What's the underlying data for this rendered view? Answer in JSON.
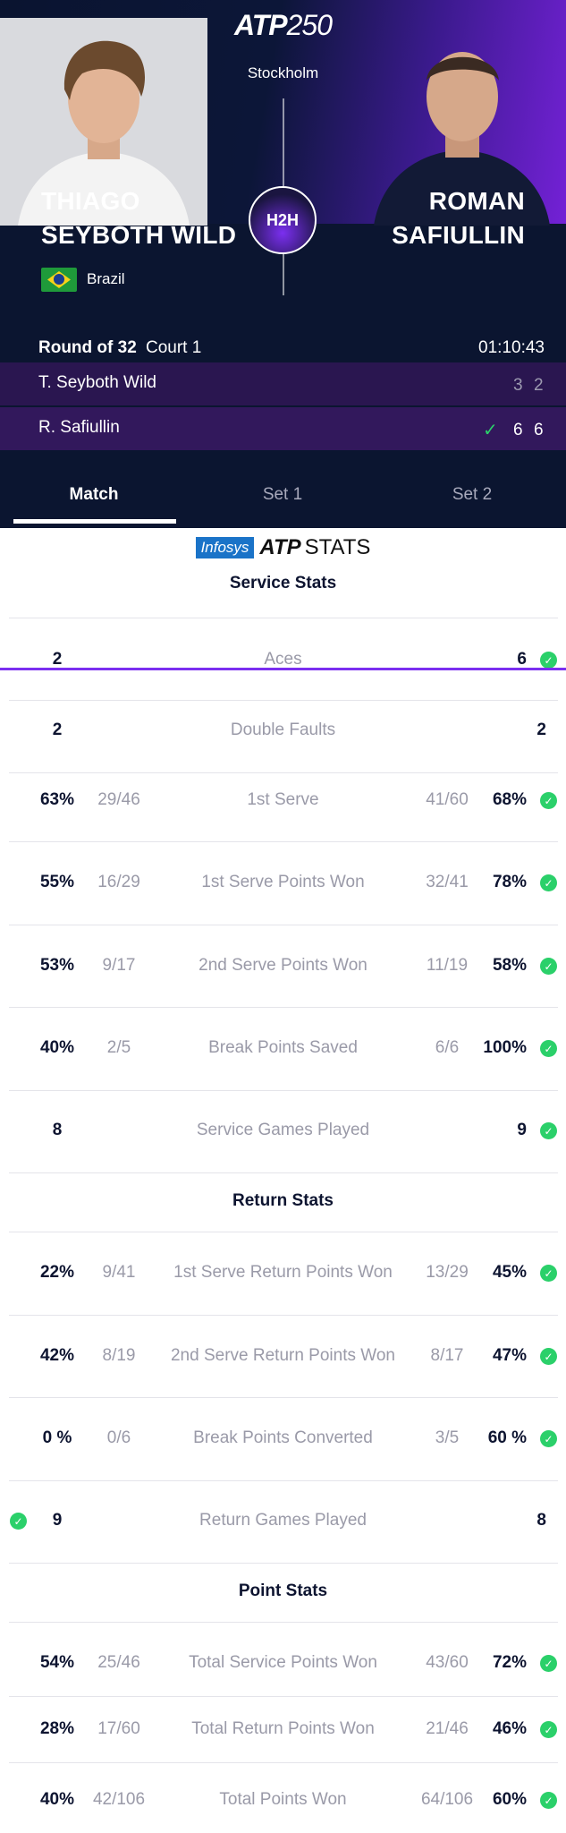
{
  "header": {
    "logo_text": "ATP",
    "logo_number": "250",
    "city": "Stockholm",
    "h2h_label": "H2H"
  },
  "players": {
    "left": {
      "first": "THIAGO",
      "last": "SEYBOTH WILD",
      "country": "Brazil"
    },
    "right": {
      "first": "ROMAN",
      "last": "SAFIULLIN"
    }
  },
  "match": {
    "round": "Round of 32",
    "court": "Court 1",
    "duration": "01:10:43",
    "rows": [
      {
        "name": "T. Seyboth Wild",
        "set1": "3",
        "set2": "2",
        "winner": false
      },
      {
        "name": "R. Safiullin",
        "set1": "6",
        "set2": "6",
        "winner": true
      }
    ]
  },
  "tabs": [
    {
      "label": "Match",
      "active": true
    },
    {
      "label": "Set 1",
      "active": false
    },
    {
      "label": "Set 2",
      "active": false
    }
  ],
  "stats_logo": {
    "infosys": "Infosys",
    "atp": "ATP",
    "stats": "STATS"
  },
  "sections": {
    "service": "Service Stats",
    "return": "Return Stats",
    "point": "Point Stats"
  },
  "service_stats": [
    {
      "label": "Aces",
      "left": "2",
      "left_frac": "",
      "right_frac": "",
      "right": "6",
      "winner": "right"
    },
    {
      "label": "Double Faults",
      "left": "2",
      "left_frac": "",
      "right_frac": "",
      "right": "2",
      "winner": ""
    },
    {
      "label": "1st Serve",
      "left": "63%",
      "left_frac": "29/46",
      "right_frac": "41/60",
      "right": "68%",
      "winner": "right"
    },
    {
      "label": "1st Serve Points Won",
      "left": "55%",
      "left_frac": "16/29",
      "right_frac": "32/41",
      "right": "78%",
      "winner": "right"
    },
    {
      "label": "2nd Serve Points Won",
      "left": "53%",
      "left_frac": "9/17",
      "right_frac": "11/19",
      "right": "58%",
      "winner": "right"
    },
    {
      "label": "Break Points Saved",
      "left": "40%",
      "left_frac": "2/5",
      "right_frac": "6/6",
      "right": "100%",
      "winner": "right"
    },
    {
      "label": "Service Games Played",
      "left": "8",
      "left_frac": "",
      "right_frac": "",
      "right": "9",
      "winner": "right"
    }
  ],
  "return_stats": [
    {
      "label": "1st Serve Return Points Won",
      "left": "22%",
      "left_frac": "9/41",
      "right_frac": "13/29",
      "right": "45%",
      "winner": "right"
    },
    {
      "label": "2nd Serve Return Points Won",
      "left": "42%",
      "left_frac": "8/19",
      "right_frac": "8/17",
      "right": "47%",
      "winner": "right"
    },
    {
      "label": "Break Points Converted",
      "left": "0 %",
      "left_frac": "0/6",
      "right_frac": "3/5",
      "right": "60 %",
      "winner": "right"
    },
    {
      "label": "Return Games Played",
      "left": "9",
      "left_frac": "",
      "right_frac": "",
      "right": "8",
      "winner": "left"
    }
  ],
  "point_stats": [
    {
      "label": "Total Service Points Won",
      "left": "54%",
      "left_frac": "25/46",
      "right_frac": "43/60",
      "right": "72%",
      "winner": "right"
    },
    {
      "label": "Total Return Points Won",
      "left": "28%",
      "left_frac": "17/60",
      "right_frac": "21/46",
      "right": "46%",
      "winner": "right"
    },
    {
      "label": "Total Points Won",
      "left": "40%",
      "left_frac": "42/106",
      "right_frac": "64/106",
      "right": "60%",
      "winner": "right"
    }
  ],
  "colors": {
    "win_check": "#2bd06a",
    "accent": "#7b2ff0",
    "panel": "#0b1530"
  }
}
